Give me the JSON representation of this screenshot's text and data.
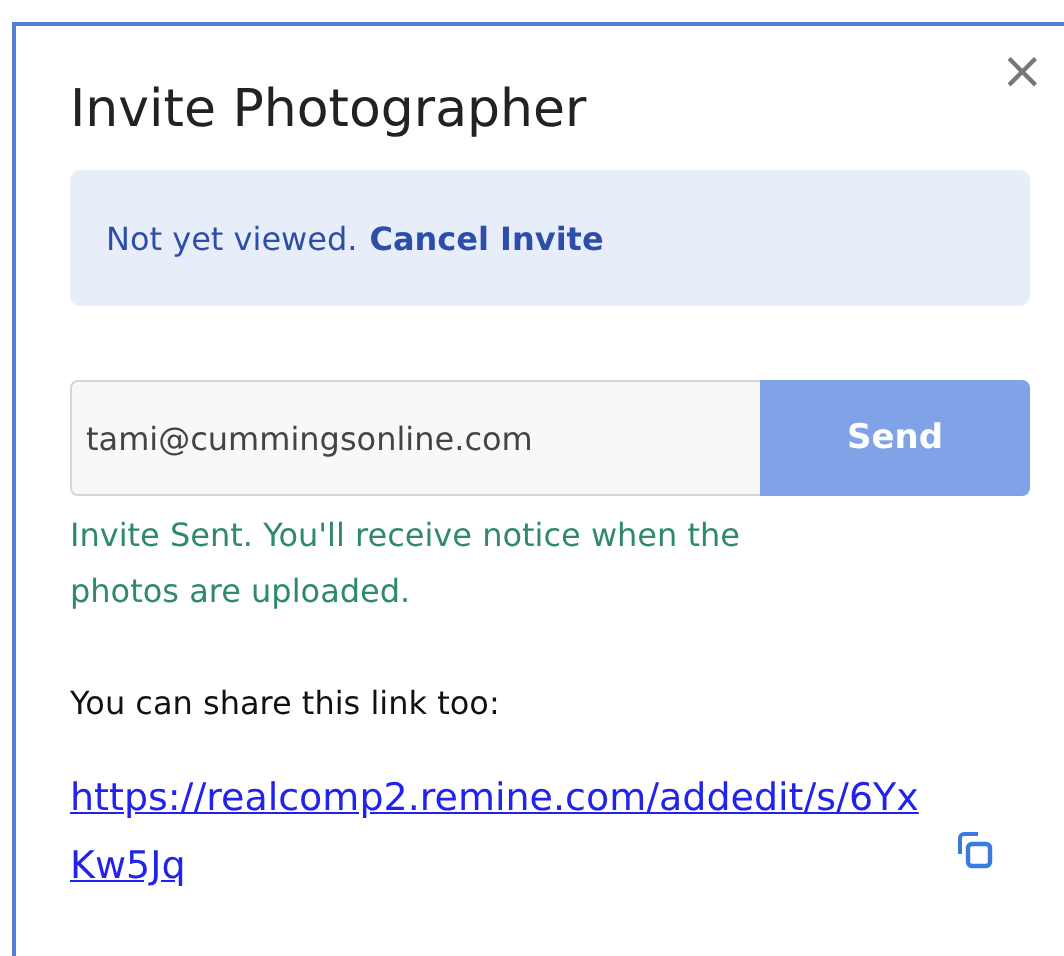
{
  "dialog": {
    "title": "Invite Photographer",
    "close": "×"
  },
  "status_banner": {
    "status": "Not yet viewed.",
    "action": "Cancel Invite"
  },
  "invite_form": {
    "email_value": "tami@cummingsonline.com",
    "button": "Send",
    "confirmation": "Invite Sent. You'll receive notice when the photos are uploaded."
  },
  "share": {
    "label": "You can share this link too:",
    "link": "https://realcomp2.remine.com/addedit/s/6YxKw5Jq"
  }
}
